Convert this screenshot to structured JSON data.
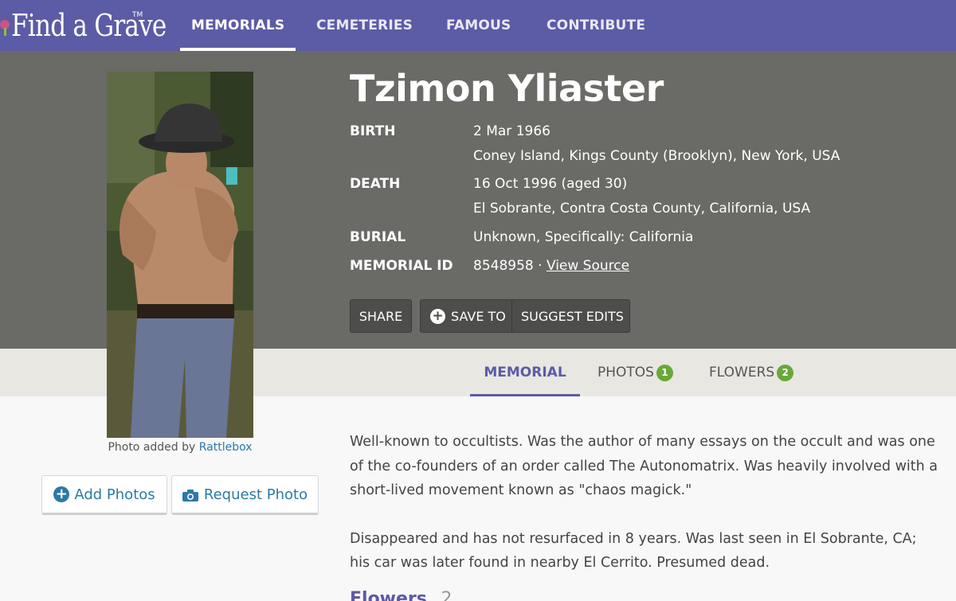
{
  "nav": {
    "logo_text": "Find a Grave",
    "logo_tm": "TM",
    "items": [
      {
        "label": "MEMORIALS"
      },
      {
        "label": "CEMETERIES"
      },
      {
        "label": "FAMOUS"
      },
      {
        "label": "CONTRIBUTE"
      }
    ]
  },
  "memorial": {
    "name": "Tzimon Yliaster",
    "birth_label": "BIRTH",
    "birth_date": "2 Mar 1966",
    "birth_place": "Coney Island, Kings County (Brooklyn), New York, USA",
    "death_label": "DEATH",
    "death_date": "16 Oct 1996 (aged 30)",
    "death_place": "El Sobrante, Contra Costa County, California, USA",
    "burial_label": "BURIAL",
    "burial_value": "Unknown, Specifically: California",
    "memorial_id_label": "MEMORIAL ID",
    "memorial_id": "8548958",
    "separator": "·",
    "view_source": "View Source"
  },
  "actions": {
    "share": "SHARE",
    "save_to": "SAVE TO",
    "suggest_edits": "SUGGEST EDITS"
  },
  "tabs": {
    "memorial": "MEMORIAL",
    "photos": "PHOTOS",
    "photos_count": "1",
    "flowers": "FLOWERS",
    "flowers_count": "2"
  },
  "photo": {
    "credit_prefix": "Photo added by",
    "credit_user": "Rattlebox",
    "add_photos": "Add Photos",
    "request_photo": "Request Photo"
  },
  "bio": {
    "p1": "Well-known to occultists. Was the author of many essays on the occult and was one of the co-founders of an order called The Autonomatrix. Was heavily involved with a short-lived movement known as \"chaos magick.\"",
    "p2": "Disappeared and has not resurfaced in 8 years. Was last seen in El Sobrante, CA; his car was later found in nearby El Cerrito. Presumed dead."
  },
  "flowers_section": {
    "title": "Flowers",
    "count": "2"
  },
  "colors": {
    "nav_bg": "#5c5ba5",
    "hero_bg": "#6a6a66",
    "tab_bar_bg": "#e8e7e2",
    "badge_green": "#6aa83a",
    "link_blue": "#2b7aa5"
  }
}
